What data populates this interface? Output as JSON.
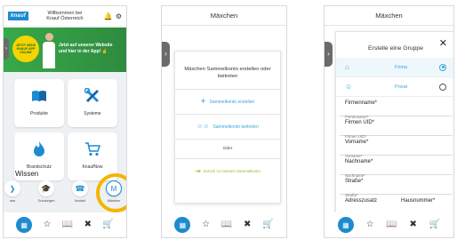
{
  "phone1": {
    "logo": "knauf",
    "welcome_line1": "Willkommen bei",
    "welcome_line2": "Knauf Österreich",
    "banner": {
      "badge": "JETZT NEUE KNAUF APP ONLINE",
      "text_line1": "Jetzt auf unserer Website",
      "text_line2": "und hier in der App!"
    },
    "tiles": [
      {
        "label": "Produkte",
        "icon": "book-icon"
      },
      {
        "label": "Systeme",
        "icon": "tools-icon"
      },
      {
        "label": "Brandschutz",
        "icon": "flame-icon"
      },
      {
        "label": "KnaufNow",
        "icon": "cart-icon"
      }
    ],
    "wissen_title": "Wissen",
    "wissen_items": [
      {
        "label": "ows",
        "icon": "play-icon"
      },
      {
        "label": "Schulungen",
        "icon": "graduation-icon"
      },
      {
        "label": "Kontakt",
        "icon": "phone-icon"
      },
      {
        "label": "Mäxchen",
        "icon": "maexchen-icon",
        "glyph": "M"
      }
    ]
  },
  "phone2": {
    "title": "Mäxchen",
    "modal_title": "Mäxchen Sammelkonto erstellen oder beitreten",
    "create_label": "Sammelkonto erstellen",
    "join_label": "Sammelkonto beitreten",
    "or_label": "Oder",
    "back_label": "Zurück zu meinem Sammelkonto"
  },
  "phone3": {
    "title": "Mäxchen",
    "modal_title": "Erstelle eine Gruppe",
    "options": [
      {
        "label": "Firma",
        "selected": true
      },
      {
        "label": "Privat",
        "selected": false
      }
    ],
    "fields": {
      "firmenname": {
        "label": "Firmenname*",
        "placeholder": "Firmenname*"
      },
      "uid": {
        "label": "Firmen UID*",
        "placeholder": "Firmen UID*"
      },
      "vorname": {
        "label": "Vorname*",
        "placeholder": "Vorname*"
      },
      "nachname": {
        "label": "Nachname*",
        "placeholder": "Nachname*"
      },
      "strasse": {
        "label": "Straße*",
        "placeholder": "Straße*"
      },
      "adresszusatz": {
        "label": "Adresszusatz",
        "placeholder": "Adresszusatz"
      },
      "hausnummer": {
        "label": "Hausnummer*",
        "placeholder": "Hausnummer*"
      }
    }
  },
  "colors": {
    "brand_blue": "#1e8bd0",
    "link_blue": "#3aa6d6",
    "highlight_ring": "#f5b400",
    "back_green": "#8bbf2a",
    "banner_green": "#39a84a"
  }
}
